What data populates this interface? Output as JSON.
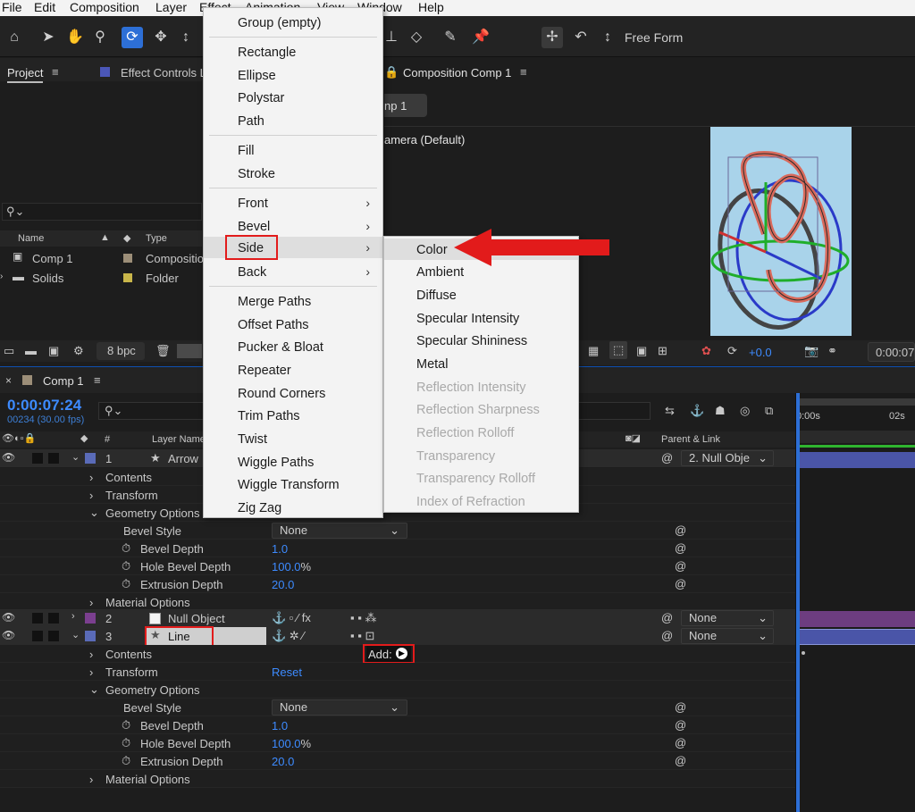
{
  "menubar": [
    "File",
    "Edit",
    "Composition",
    "Layer",
    "Effect",
    "Animation",
    "View",
    "Window",
    "Help"
  ],
  "toolbar": {
    "free_form": "Free Form"
  },
  "project_panel": {
    "tab_project": "Project",
    "tab_effect_controls": "Effect Controls L",
    "search_placeholder": "",
    "col_name": "Name",
    "col_type": "Type",
    "items": [
      {
        "name": "Comp 1",
        "type": "Compositio"
      },
      {
        "name": "Solids",
        "type": "Folder"
      }
    ],
    "bpc": "8 bpc"
  },
  "comp_panel": {
    "tab": "Composition Comp 1",
    "comp_tab": "np 1",
    "camera": "amera (Default)",
    "exposure": "+0.0",
    "time": "0:00:07"
  },
  "timeline": {
    "tab": "Comp 1",
    "timecode": "0:00:07:24",
    "frames": "00234 (30.00 fps)",
    "col_hash": "#",
    "col_layer_name": "Layer Name",
    "col_parent": "Parent & Link",
    "ruler": [
      "0:00s",
      "02s"
    ],
    "layers": [
      {
        "num": "1",
        "name": "Arrow",
        "parent": "2. Null Obje",
        "color": "#5a6bb8"
      },
      {
        "num": "2",
        "name": "Null Object",
        "parent": "None",
        "color": "#7b3f8f"
      },
      {
        "num": "3",
        "name": "Line",
        "parent": "None",
        "color": "#5a6bb8"
      }
    ],
    "arrow_props": {
      "contents": "Contents",
      "transform": "Transform",
      "geometry": "Geometry Options",
      "bevel_style": "Bevel Style",
      "bevel_style_value": "None",
      "bevel_depth": "Bevel Depth",
      "bevel_depth_value": "1.0",
      "hole_bevel_depth": "Hole Bevel Depth",
      "hole_bevel_depth_value": "100.0",
      "hole_bevel_unit": "%",
      "extrusion_depth": "Extrusion Depth",
      "extrusion_depth_value": "20.0",
      "material": "Material Options"
    },
    "line_props": {
      "contents": "Contents",
      "add": "Add:",
      "transform": "Transform",
      "reset": "Reset",
      "geometry": "Geometry Options",
      "bevel_style": "Bevel Style",
      "bevel_style_value": "None",
      "bevel_depth": "Bevel Depth",
      "bevel_depth_value": "1.0",
      "hole_bevel_depth": "Hole Bevel Depth",
      "hole_bevel_depth_value": "100.0",
      "hole_bevel_unit": "%",
      "extrusion_depth": "Extrusion Depth",
      "extrusion_depth_value": "20.0",
      "material": "Material Options"
    }
  },
  "add_menu": {
    "items": [
      "Group (empty)",
      "Rectangle",
      "Ellipse",
      "Polystar",
      "Path",
      "Fill",
      "Stroke",
      "Front",
      "Bevel",
      "Side",
      "Back",
      "Merge Paths",
      "Offset Paths",
      "Pucker & Bloat",
      "Repeater",
      "Round Corners",
      "Trim Paths",
      "Twist",
      "Wiggle Paths",
      "Wiggle Transform",
      "Zig Zag"
    ]
  },
  "side_submenu": {
    "enabled": [
      "Color",
      "Ambient",
      "Diffuse",
      "Specular Intensity",
      "Specular Shininess",
      "Metal"
    ],
    "disabled": [
      "Reflection Intensity",
      "Reflection Sharpness",
      "Reflection Rolloff",
      "Transparency",
      "Transparency Rolloff",
      "Index of Refraction"
    ]
  },
  "colors": {
    "highlight": "#e21b1b",
    "timecode": "#3d8bff",
    "preview_bg": "#a9d3ea"
  }
}
